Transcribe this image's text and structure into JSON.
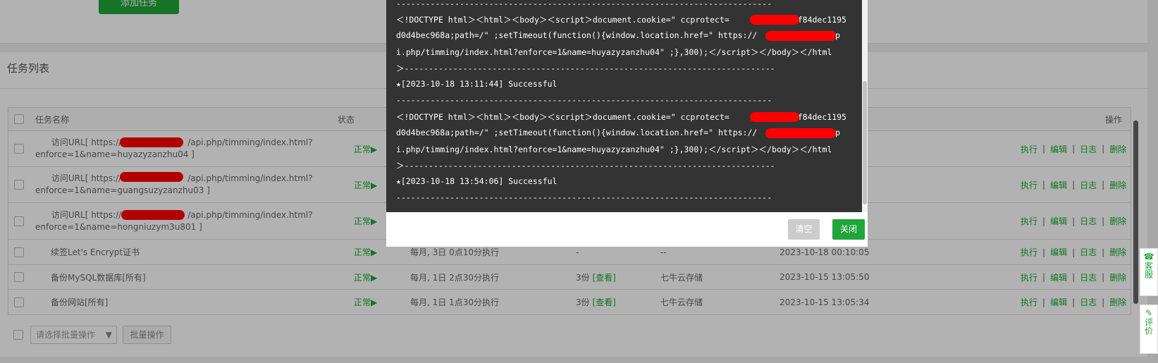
{
  "top": {
    "add_task_label": "添加任务"
  },
  "panel": {
    "title": "任务列表"
  },
  "table": {
    "headers": {
      "name": "任务名称",
      "status": "状态",
      "ops": "操作"
    },
    "rows": [
      {
        "name_line1": "访问URL[ https://",
        "name_line1b": "/api.php/timming/index.html?",
        "name_line2": "enforce=1&name=huyazyzanzhu04 ]",
        "status": "正常▶"
      },
      {
        "name_line1": "访问URL[ https://",
        "name_line1b": "/api.php/timming/index.html?",
        "name_line2": "enforce=1&name=guangsuzyzanzhu03 ]",
        "status": "正常▶"
      },
      {
        "name_line1": "访问URL[ https://",
        "name_line1b": "/api.php/timming/index.html?",
        "name_line2": "enforce=1&name=hongniuzym3u801 ]",
        "status": "正常▶"
      },
      {
        "name": "续签Let's Encrypt证书",
        "status": "正常▶",
        "period": "每月, 3日 0点10分执行",
        "keep": "-",
        "backup_to": "--",
        "time": "2023-10-18 00:10:05"
      },
      {
        "name": "备份MySQL数据库[所有]",
        "status": "正常▶",
        "period": "每月, 1日 2点30分执行",
        "keep": "3份",
        "view": "[查看]",
        "backup_to": "七牛云存储",
        "time": "2023-10-15 13:05:50"
      },
      {
        "name": "备份网站[所有]",
        "status": "正常▶",
        "period": "每月, 1日 1点30分执行",
        "keep": "3份",
        "view": "[查看]",
        "backup_to": "七牛云存储",
        "time": "2023-10-15 13:05:34"
      }
    ],
    "ops": {
      "run": "执行",
      "edit": "编辑",
      "log": "日志",
      "delete": "删除",
      "sep": "|"
    }
  },
  "batch": {
    "select_placeholder": "请选择批量操作",
    "button": "批量操作"
  },
  "float": {
    "service": "客服",
    "review": "评价"
  },
  "modal": {
    "lines": [
      "-----------------------------------------------------------------------------",
      "＜!DOCTYPE html＞＜html＞＜body＞＜script＞document.cookie=\" ccprotect=           a03f84dec1195",
      "d0d4bec968a;path=/\" ;setTimeout(function(){window.location.href=\" https://              /ap",
      "i.php/timming/index.html?enforce=1&name=huyazyzanzhu04\" ;},300);＜/script＞＜/body＞＜/html",
      "＞----------------------------------------------------------------------------",
      "★[2023-10-18 13:11:44] Successful",
      "-----------------------------------------------------------------------------",
      "＜!DOCTYPE html＞＜html＞＜body＞＜script＞document.cookie=\" ccprotect=           a03f84dec1195",
      "d0d4bec968a;path=/\" ;setTimeout(function(){window.location.href=\" https://              /ap",
      "i.php/timming/index.html?enforce=1&name=huyazyzanzhu04\" ;},300);＜/script＞＜/body＞＜/html",
      "＞----------------------------------------------------------------------------",
      "★[2023-10-18 13:54:06] Successful",
      "-----------------------------------------------------------------------------"
    ],
    "clear_label": "清空",
    "close_label": "关闭"
  },
  "colors": {
    "accent": "#20a53a",
    "console_bg": "#333333",
    "redaction": "#ff0000"
  }
}
